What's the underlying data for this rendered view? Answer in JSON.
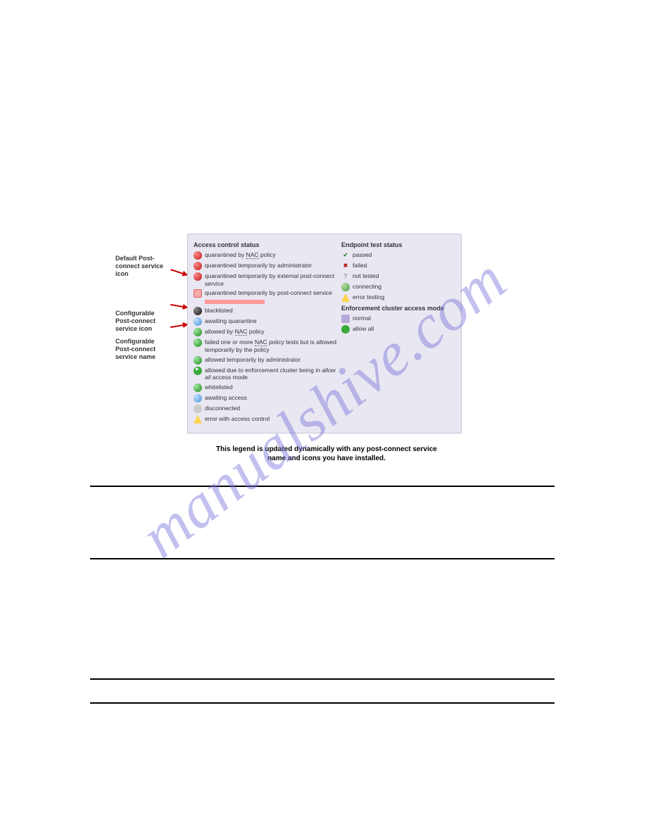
{
  "watermark": "manualshive.com",
  "callouts": {
    "c1": "Default Post-connect service icon",
    "c2": "Configurable Post-connect service icon",
    "c3": "Configurable Post-connect service name"
  },
  "legend": {
    "left_header": "Access control status",
    "left_items": [
      "quarantined by NAC policy",
      "quarantined temporarily by administrator",
      "quarantined temporarily by external post-connect service",
      "quarantined temporarily by post-connect service",
      "blacklisted",
      "awaiting quarantine",
      "allowed by NAC policy",
      "failed one or more NAC policy tests but is allowed temporarily by the policy",
      "allowed temporarily by administrator",
      "allowed due to enforcement cluster being in allow all access mode",
      "whitelisted",
      "awaiting access",
      "disconnected",
      "error with access control"
    ],
    "right_header1": "Endpoint test status",
    "right_items1": [
      "passed",
      "failed",
      "not tested",
      "connecting",
      "error testing"
    ],
    "right_header2": "Enforcement cluster access mode",
    "right_items2": [
      "normal",
      "allow all"
    ]
  },
  "caption": "This legend is updated dynamically with any post-connect service name and icons you have installed."
}
